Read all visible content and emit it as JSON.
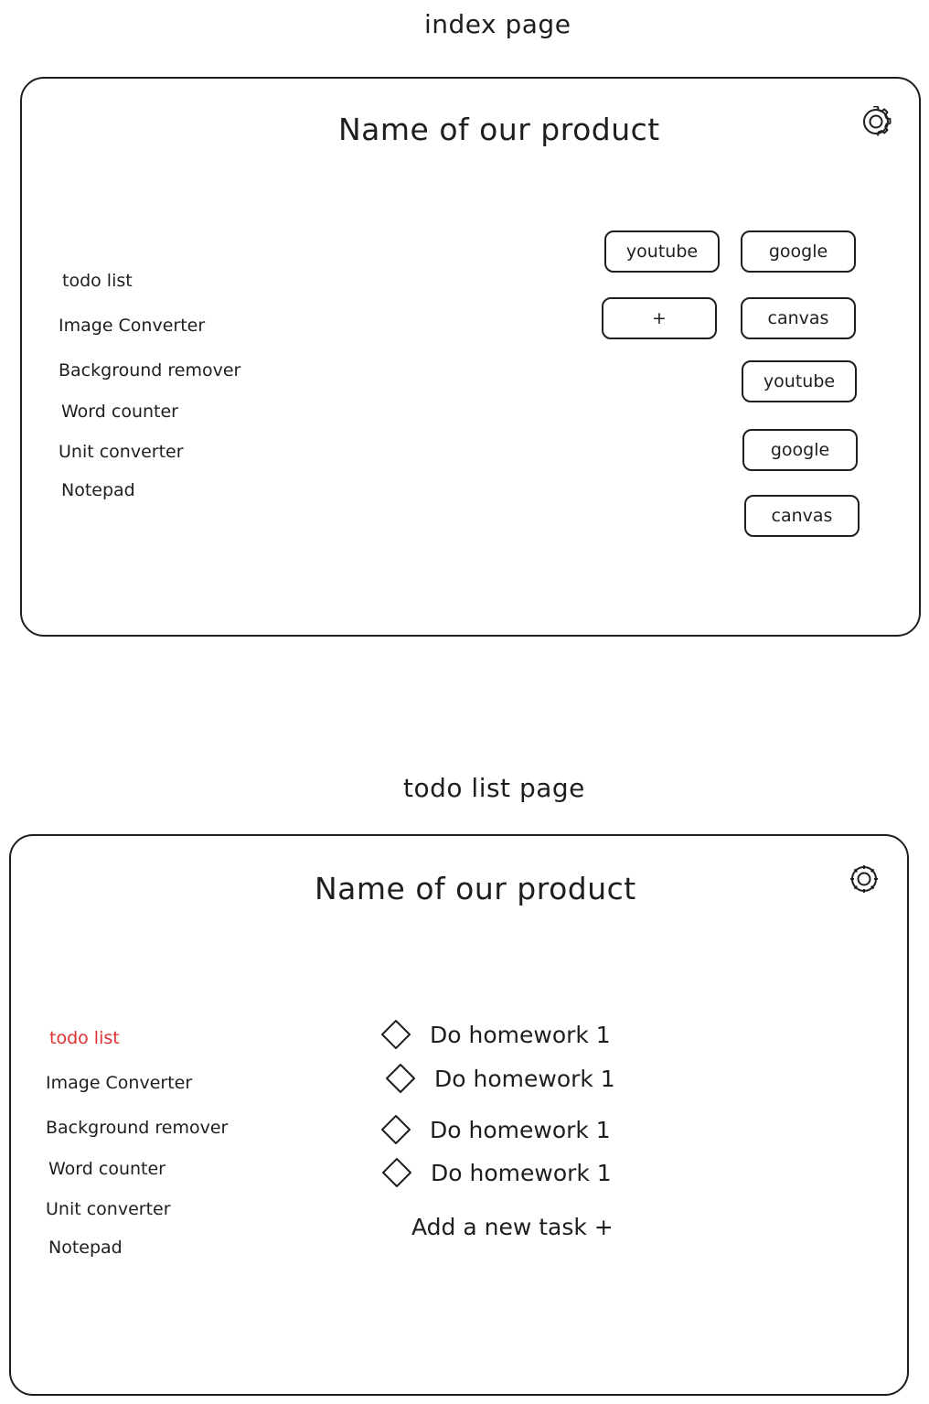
{
  "index_page": {
    "label": "index page",
    "product_title": "Name of our product",
    "settings_icon": "gear-icon",
    "sidebar": [
      "todo list",
      "Image Converter",
      "Background remover",
      "Word counter",
      "Unit converter",
      "Notepad"
    ],
    "shortcuts": {
      "grid": [
        "youtube",
        "google",
        "+",
        "canvas"
      ],
      "column": [
        "youtube",
        "google",
        "canvas"
      ]
    }
  },
  "todo_page": {
    "label": "todo list page",
    "product_title": "Name of our product",
    "settings_icon": "gear-icon",
    "sidebar": [
      "todo list",
      "Image Converter",
      "Background remover",
      "Word counter",
      "Unit converter",
      "Notepad"
    ],
    "active_item": "todo list",
    "active_color": "#e03131",
    "tasks": [
      "Do homework 1",
      "Do homework 1",
      "Do homework 1",
      "Do homework 1"
    ],
    "add_task_label": "Add a new task +"
  }
}
